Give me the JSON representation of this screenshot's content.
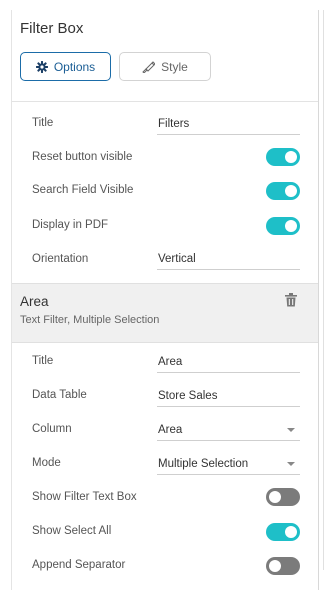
{
  "header": {
    "title": "Filter Box"
  },
  "tabs": [
    {
      "label": "Options",
      "icon": "gear-icon",
      "active": true
    },
    {
      "label": "Style",
      "icon": "paint-brush-icon",
      "active": false
    }
  ],
  "general": {
    "title_label": "Title",
    "title_value": "Filters",
    "reset_label": "Reset button visible",
    "reset_on": true,
    "search_label": "Search Field Visible",
    "search_on": true,
    "pdf_label": "Display in PDF",
    "pdf_on": true,
    "orientation_label": "Orientation",
    "orientation_value": "Vertical"
  },
  "filter": {
    "name": "Area",
    "description": "Text Filter, Multiple Selection",
    "title_label": "Title",
    "title_value": "Area",
    "table_label": "Data Table",
    "table_value": "Store Sales",
    "column_label": "Column",
    "column_value": "Area",
    "mode_label": "Mode",
    "mode_value": "Multiple Selection",
    "show_text_box_label": "Show Filter Text Box",
    "show_text_box_on": false,
    "select_all_label": "Show Select All",
    "select_all_on": true,
    "separator_label": "Append Separator",
    "separator_on": false
  },
  "colors": {
    "toggle_on": "#1ebfc8",
    "toggle_off": "#7b7b7b",
    "accent": "#1b6ca8"
  }
}
